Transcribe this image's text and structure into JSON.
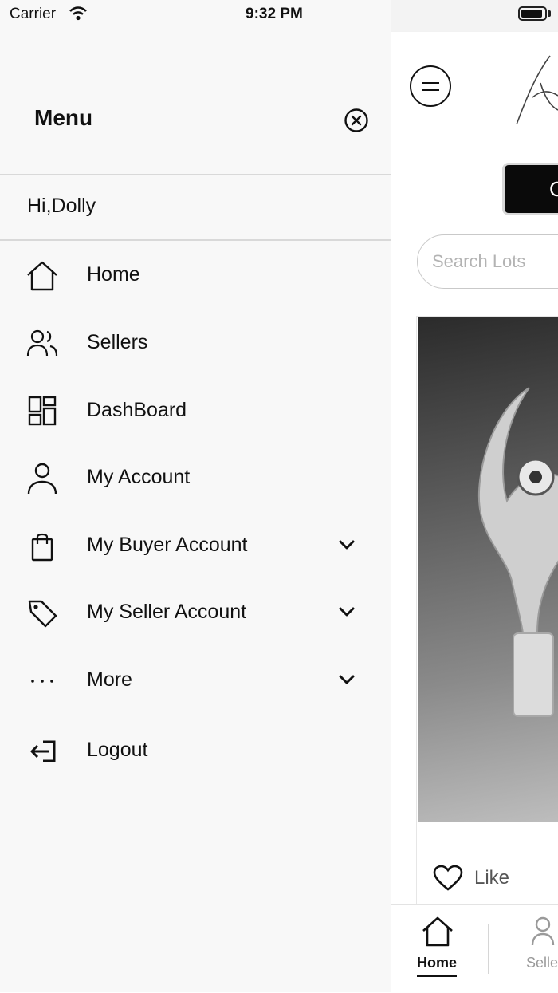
{
  "status_bar": {
    "carrier": "Carrier",
    "time": "9:32 PM"
  },
  "drawer": {
    "title": "Menu",
    "greeting": "Hi,Dolly",
    "items": [
      {
        "label": "Home",
        "icon": "home-icon",
        "expandable": false
      },
      {
        "label": "Sellers",
        "icon": "users-icon",
        "expandable": false
      },
      {
        "label": "DashBoard",
        "icon": "dashboard-icon",
        "expandable": false
      },
      {
        "label": "My Account",
        "icon": "user-icon",
        "expandable": false
      },
      {
        "label": "My Buyer Account",
        "icon": "shopping-bag-icon",
        "expandable": true
      },
      {
        "label": "My Seller Account",
        "icon": "tag-icon",
        "expandable": true
      },
      {
        "label": "More",
        "icon": "more-dots-icon",
        "expandable": true
      },
      {
        "label": "Logout",
        "icon": "logout-icon",
        "expandable": false
      }
    ]
  },
  "app": {
    "button_partial_label": "C",
    "search": {
      "placeholder": "Search Lots"
    },
    "lot_card": {
      "like_label": "Like"
    },
    "tabs": [
      {
        "label": "Home",
        "icon": "home-icon",
        "active": true
      },
      {
        "label": "Selle",
        "icon": "users-icon",
        "active": false
      }
    ]
  },
  "colors": {
    "drawer_bg": "#f8f8f8",
    "text": "#111111",
    "divider": "#d9d9d9",
    "inactive_tab": "#9a9a9a"
  }
}
